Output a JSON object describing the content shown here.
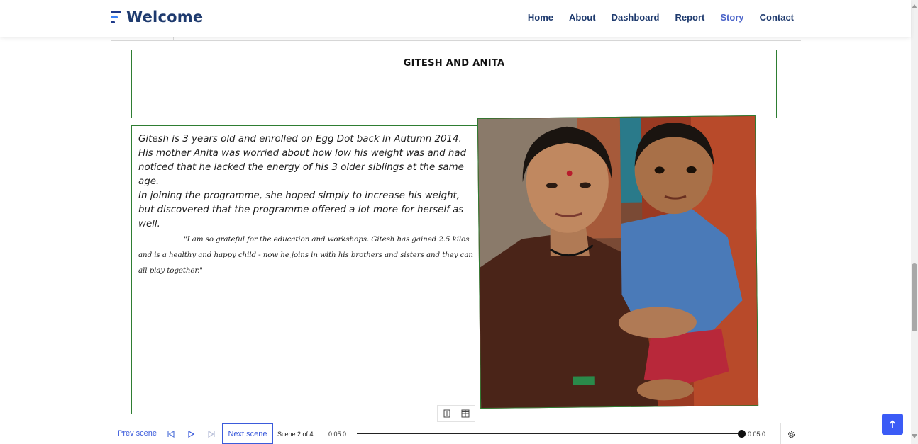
{
  "header": {
    "brand_title": "Welcome",
    "nav": [
      {
        "label": "Home"
      },
      {
        "label": "About"
      },
      {
        "label": "Dashboard"
      },
      {
        "label": "Report"
      },
      {
        "label": "Story",
        "active": true
      },
      {
        "label": "Contact"
      }
    ]
  },
  "story": {
    "title": "GITESH AND ANITA",
    "paragraph_1": "Gitesh is 3 years old and enrolled on Egg Dot back in Autumn 2014. His mother Anita was worried about how low his weight was and had noticed that he lacked the energy of his 3 older siblings at the same age.",
    "paragraph_2": "In joining the programme, she hoped simply to increase his weight, but discovered that the programme offered a lot more for herself as well.",
    "quote": "\"I am so grateful for the education and workshops. Gitesh has gained 2.5 kilos and is a healthy and happy child - now he joins in with his brothers and sisters and they can all play together.\""
  },
  "player": {
    "prev_scene": "Prev scene",
    "next_scene": "Next scene",
    "scene_counter": "Scene 2 of 4",
    "time_start": "0:05.0",
    "time_end": "0:05.0",
    "progress_fraction": 1.0
  },
  "colors": {
    "accent": "#3b5bdb",
    "brand": "#1e3a6e",
    "frame_border": "#2e7d32",
    "to_top_button": "#3b5bf6"
  },
  "icons": {
    "brand": "menu-lines-icon",
    "skip_back": "skip-back-icon",
    "play": "play-icon",
    "skip_forward": "skip-forward-icon",
    "notes": "document-icon",
    "grid": "grid-icon",
    "settings": "gear-icon",
    "to_top": "arrow-up-icon"
  }
}
